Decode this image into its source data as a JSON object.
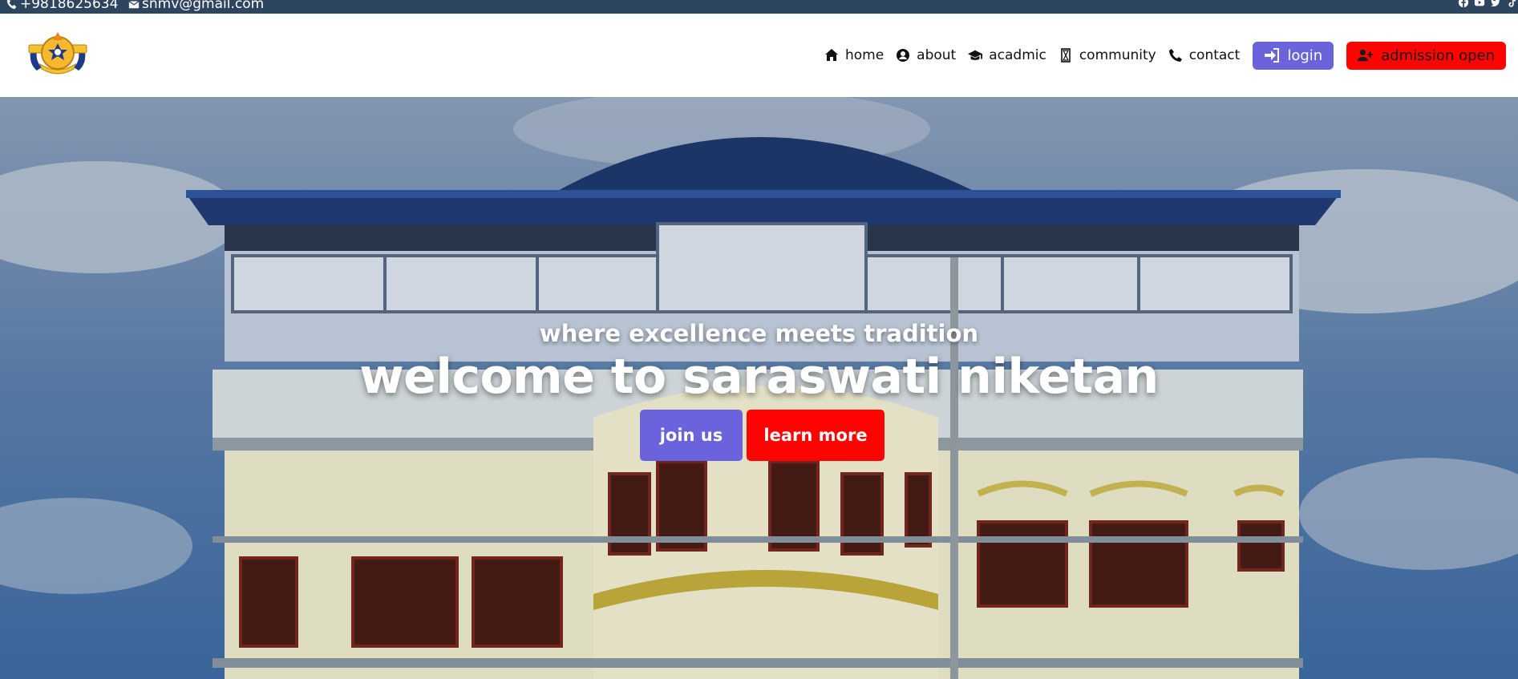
{
  "topbar": {
    "phone": "+9818625634",
    "email": "snmv@gmail.com",
    "social_icons": [
      "facebook-icon",
      "youtube-icon",
      "twitter-icon",
      "tiktok-icon"
    ]
  },
  "header": {
    "logo_icon": "school-crest-logo",
    "nav": [
      {
        "label": "home",
        "icon": "home-icon"
      },
      {
        "label": "about",
        "icon": "user-circle-icon"
      },
      {
        "label": "acadmic",
        "icon": "graduation-cap-icon"
      },
      {
        "label": "community",
        "icon": "hourglass-icon"
      },
      {
        "label": "contact",
        "icon": "phone-icon"
      }
    ],
    "login_label": "login",
    "admission_label": "admission open"
  },
  "hero": {
    "subtitle": "where excellence meets tradition",
    "title": "welcome to saraswati niketan",
    "join_label": "join us",
    "learn_label": "learn more"
  },
  "colors": {
    "topbar_bg": "#2e4561",
    "accent_purple": "#6a63dc",
    "accent_red": "#ff0303"
  }
}
